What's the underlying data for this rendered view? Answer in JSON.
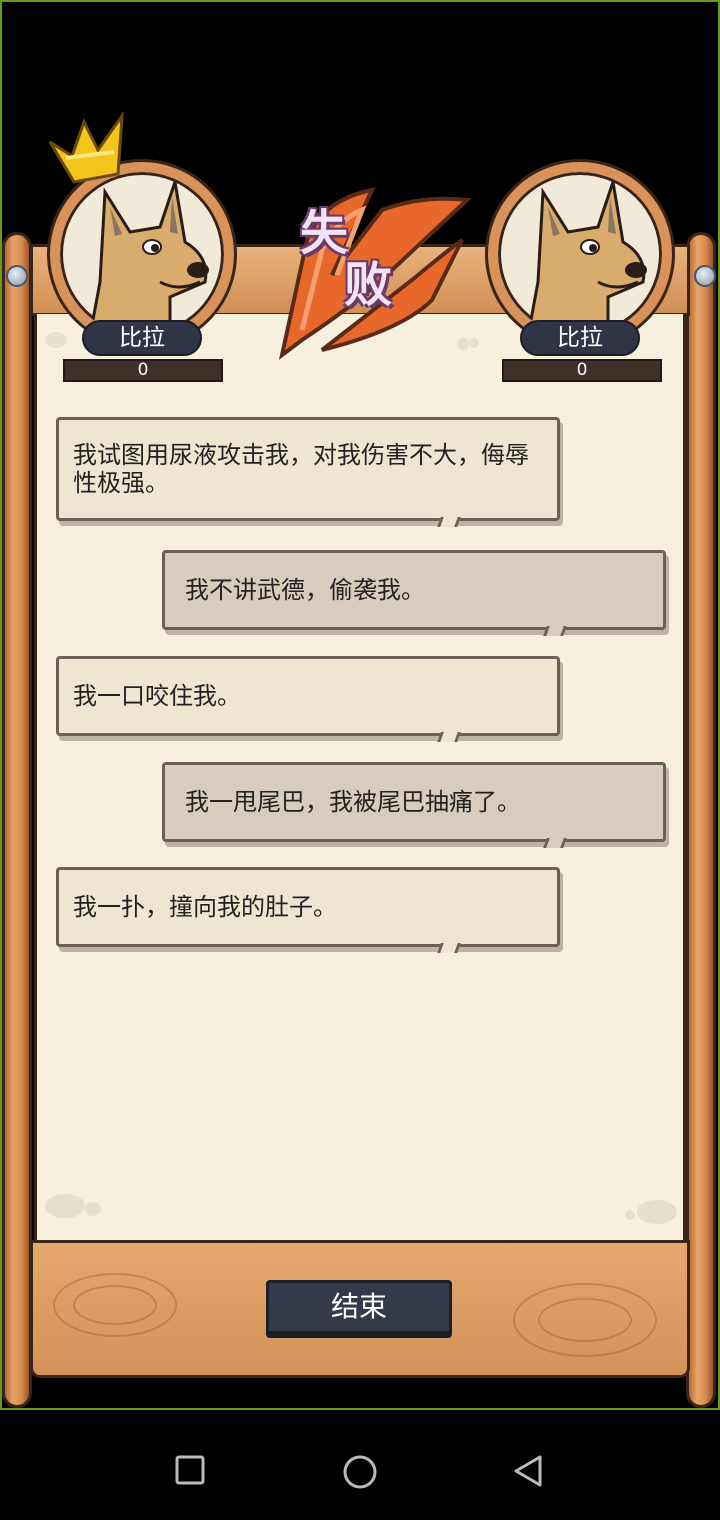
{
  "result": {
    "line1": "失",
    "line2": "败"
  },
  "players": {
    "left": {
      "name": "比拉",
      "score": "0"
    },
    "right": {
      "name": "比拉",
      "score": "0"
    }
  },
  "messages": [
    {
      "side": "left",
      "text": "我试图用尿液攻击我，对我伤害不大，侮辱性极强。"
    },
    {
      "side": "right",
      "text": "我不讲武德，偷袭我。"
    },
    {
      "side": "left",
      "text": "我一口咬住我。"
    },
    {
      "side": "right",
      "text": "我一甩尾巴，我被尾巴抽痛了。"
    },
    {
      "side": "left",
      "text": "我一扑，撞向我的肚子。"
    }
  ],
  "footer": {
    "end_label": "结束"
  },
  "colors": {
    "wood": "#d9935a",
    "parchment": "#f7f0dc",
    "badge": "#e8682c",
    "button": "#343a4a"
  },
  "icons": {
    "crown": "crown-icon",
    "nav_recent": "square-icon",
    "nav_home": "circle-icon",
    "nav_back": "triangle-back-icon"
  }
}
